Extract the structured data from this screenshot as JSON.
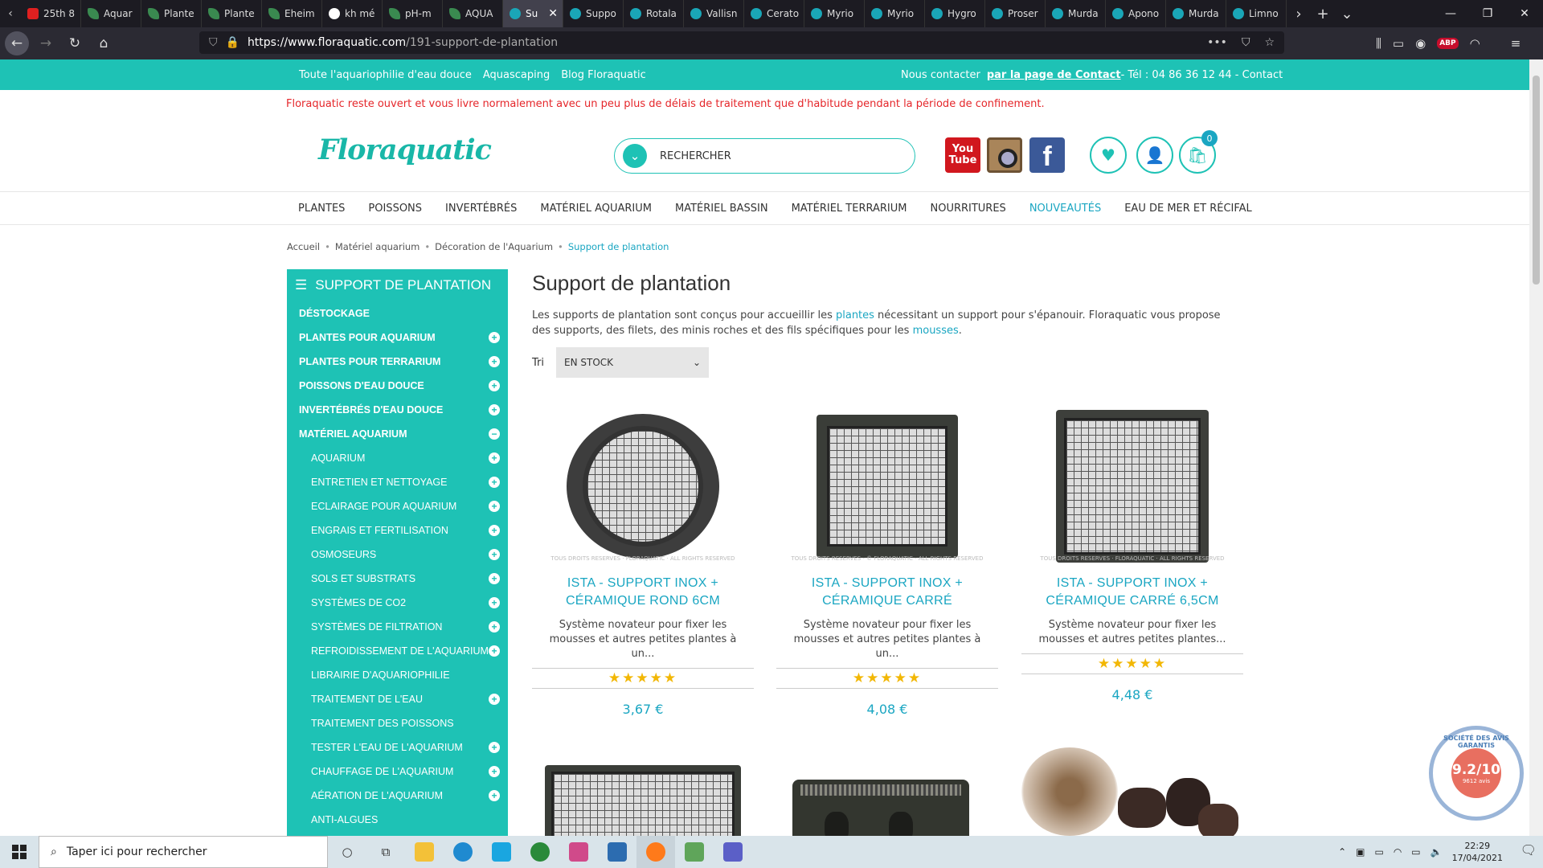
{
  "browser": {
    "tabs": [
      {
        "label": "25th 8",
        "icon": "youtube-icon"
      },
      {
        "label": "Aquar",
        "icon": "leaf-icon"
      },
      {
        "label": "Plante",
        "icon": "leaf-icon"
      },
      {
        "label": "Plante",
        "icon": "leaf-icon"
      },
      {
        "label": "Eheim",
        "icon": "leaf-icon"
      },
      {
        "label": "kh mé",
        "icon": "google-icon"
      },
      {
        "label": "pH-m",
        "icon": "site-icon"
      },
      {
        "label": "AQUA",
        "icon": "site-icon"
      },
      {
        "label": "Su",
        "icon": "floraquatic-icon",
        "active": true
      },
      {
        "label": "Suppo",
        "icon": "floraquatic-icon"
      },
      {
        "label": "Rotala",
        "icon": "floraquatic-icon"
      },
      {
        "label": "Vallisn",
        "icon": "floraquatic-icon"
      },
      {
        "label": "Cerato",
        "icon": "floraquatic-icon"
      },
      {
        "label": "Myrio",
        "icon": "floraquatic-icon"
      },
      {
        "label": "Myrio",
        "icon": "floraquatic-icon"
      },
      {
        "label": "Hygro",
        "icon": "floraquatic-icon"
      },
      {
        "label": "Proser",
        "icon": "floraquatic-icon"
      },
      {
        "label": "Murda",
        "icon": "floraquatic-icon"
      },
      {
        "label": "Apono",
        "icon": "floraquatic-icon"
      },
      {
        "label": "Murda",
        "icon": "floraquatic-icon"
      },
      {
        "label": "Limno",
        "icon": "floraquatic-icon"
      }
    ],
    "url_host": "https://www.floraquatic.com",
    "url_path": "/191-support-de-plantation"
  },
  "topbar": {
    "links": [
      "Toute l'aquariophilie d'eau douce",
      "Aquascaping",
      "Blog Floraquatic"
    ],
    "contact_label": "Nous contacter",
    "contact_link": "par la page de Contact ",
    "phone": "- Tél : 04 86 36 12 44 - Contact"
  },
  "notice": "Floraquatic reste ouvert et vous livre normalement avec un peu plus de délais de traitement que d'habitude pendant la période de confinement.",
  "header": {
    "logo": "Floraquatic",
    "search_placeholder": "RECHERCHER",
    "youtube_label": "You Tube",
    "facebook_label": "f",
    "cart_count": "0"
  },
  "menu": [
    "PLANTES",
    "POISSONS",
    "INVERTÉBRÉS",
    "MATÉRIEL AQUARIUM",
    "MATÉRIEL BASSIN",
    "MATÉRIEL TERRARIUM",
    "NOURRITURES",
    "NOUVEAUTÉS",
    "EAU DE MER ET RÉCIFAL"
  ],
  "breadcrumb": [
    "Accueil",
    "Matériel aquarium",
    "Décoration de l'Aquarium",
    "Support de plantation"
  ],
  "sidebar": {
    "title": "SUPPORT DE PLANTATION",
    "items": [
      {
        "label": "DÉSTOCKAGE",
        "sub": false,
        "toggle": ""
      },
      {
        "label": "PLANTES POUR AQUARIUM",
        "sub": false,
        "toggle": "+"
      },
      {
        "label": "PLANTES POUR TERRARIUM",
        "sub": false,
        "toggle": "+"
      },
      {
        "label": "POISSONS D'EAU DOUCE",
        "sub": false,
        "toggle": "+"
      },
      {
        "label": "INVERTÉBRÉS D'EAU DOUCE",
        "sub": false,
        "toggle": "+"
      },
      {
        "label": "MATÉRIEL AQUARIUM",
        "sub": false,
        "toggle": "−"
      },
      {
        "label": "AQUARIUM",
        "sub": true,
        "toggle": "+"
      },
      {
        "label": "ENTRETIEN ET NETTOYAGE",
        "sub": true,
        "toggle": "+"
      },
      {
        "label": "ECLAIRAGE POUR AQUARIUM",
        "sub": true,
        "toggle": "+"
      },
      {
        "label": "ENGRAIS ET FERTILISATION",
        "sub": true,
        "toggle": "+"
      },
      {
        "label": "OSMOSEURS",
        "sub": true,
        "toggle": "+"
      },
      {
        "label": "SOLS ET SUBSTRATS",
        "sub": true,
        "toggle": "+"
      },
      {
        "label": "SYSTÈMES DE CO2",
        "sub": true,
        "toggle": "+"
      },
      {
        "label": "SYSTÈMES DE FILTRATION",
        "sub": true,
        "toggle": "+"
      },
      {
        "label": "REFROIDISSEMENT DE L'AQUARIUM",
        "sub": true,
        "toggle": "+"
      },
      {
        "label": "LIBRAIRIE D'AQUARIOPHILIE",
        "sub": true,
        "toggle": ""
      },
      {
        "label": "TRAITEMENT DE L'EAU",
        "sub": true,
        "toggle": "+"
      },
      {
        "label": "TRAITEMENT DES POISSONS",
        "sub": true,
        "toggle": ""
      },
      {
        "label": "TESTER L'EAU DE L'AQUARIUM",
        "sub": true,
        "toggle": "+"
      },
      {
        "label": "CHAUFFAGE DE L'AQUARIUM",
        "sub": true,
        "toggle": "+"
      },
      {
        "label": "AÉRATION DE L'AQUARIUM",
        "sub": true,
        "toggle": "+"
      },
      {
        "label": "ANTI-ALGUES",
        "sub": true,
        "toggle": ""
      }
    ]
  },
  "main": {
    "title": "Support de plantation",
    "desc_1": "Les supports de plantation sont conçus pour accueillir les ",
    "desc_link1": "plantes",
    "desc_2": " nécessitant un support pour s'épanouir. Floraquatic vous propose des supports, des filets, des minis roches et des fils spécifiques pour les ",
    "desc_link2": "mousses",
    "desc_3": ".",
    "sort_label": "Tri",
    "sort_value": "EN STOCK",
    "products": [
      {
        "name_1": "ISTA - SUPPORT INOX +",
        "name_2": "CÉRAMIQUE ROND 6CM",
        "desc_1": "Système novateur pour fixer les",
        "desc_2": "mousses et autres petites plantes à un...",
        "price": "3,67 €",
        "rating": 5,
        "watermark": "TOUS DROITS RESERVES · FLORAQUATIC · ALL RIGHTS RESERVED"
      },
      {
        "name_1": "ISTA - SUPPORT INOX +",
        "name_2": "CÉRAMIQUE CARRÉ",
        "desc_1": "Système novateur pour fixer les",
        "desc_2": "mousses et autres petites plantes à un...",
        "price": "4,08 €",
        "rating": 5,
        "watermark": "TOUS DROITS RESERVES - © FLORAQUATIC - ALL RIGHTS RESERVED"
      },
      {
        "name_1": "ISTA - SUPPORT INOX +",
        "name_2": "CÉRAMIQUE CARRÉ 6,5CM",
        "desc_1": "Système novateur pour fixer les",
        "desc_2": "mousses et autres petites plantes...",
        "price": "4,48 €",
        "rating": 5,
        "watermark": "TOUS DROITS RESERVES · FLORAQUATIC · ALL RIGHTS RESERVED"
      }
    ]
  },
  "avis_badge": {
    "ring": "SOCIÉTÉ DES AVIS GARANTIS",
    "score": "9.2/10",
    "count": "9612 avis"
  },
  "taskbar": {
    "search_placeholder": "Taper ici pour rechercher",
    "time": "22:29",
    "date": "17/04/2021"
  }
}
